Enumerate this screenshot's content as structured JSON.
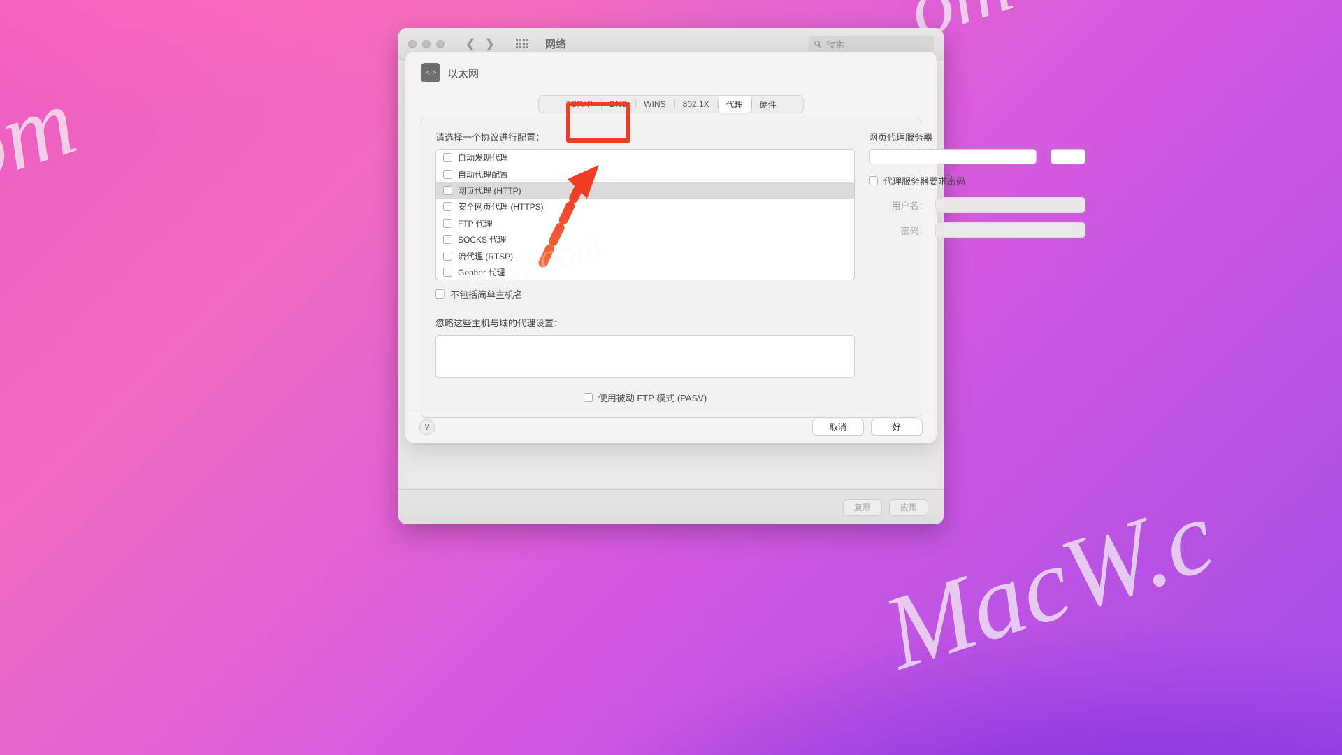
{
  "watermark": {
    "text1": "om",
    "text2": ".com",
    "text3": "MacW.c",
    "text4": "MacW.com"
  },
  "window": {
    "title": "网络",
    "search_placeholder": "搜索",
    "restore": "复原",
    "apply": "应用"
  },
  "sheet": {
    "interface": "以太网",
    "tabs": [
      "TCP/IP",
      "DNS",
      "WINS",
      "802.1X",
      "代理",
      "硬件"
    ],
    "active_tab_index": 4,
    "left": {
      "label": "请选择一个协议进行配置：",
      "protocols": [
        "自动发现代理",
        "自动代理配置",
        "网页代理 (HTTP)",
        "安全网页代理 (HTTPS)",
        "FTP 代理",
        "SOCKS 代理",
        "流代理 (RTSP)",
        "Gopher 代理"
      ],
      "selected_index": 2,
      "exclude_simple": "不包括简单主机名",
      "bypass_label": "忽略这些主机与域的代理设置："
    },
    "right": {
      "label": "网页代理服务器",
      "require_pw": "代理服务器要求密码",
      "user_label": "用户名：",
      "pass_label": "密码："
    },
    "pasv": "使用被动 FTP 模式 (PASV)",
    "cancel": "取消",
    "ok": "好"
  }
}
